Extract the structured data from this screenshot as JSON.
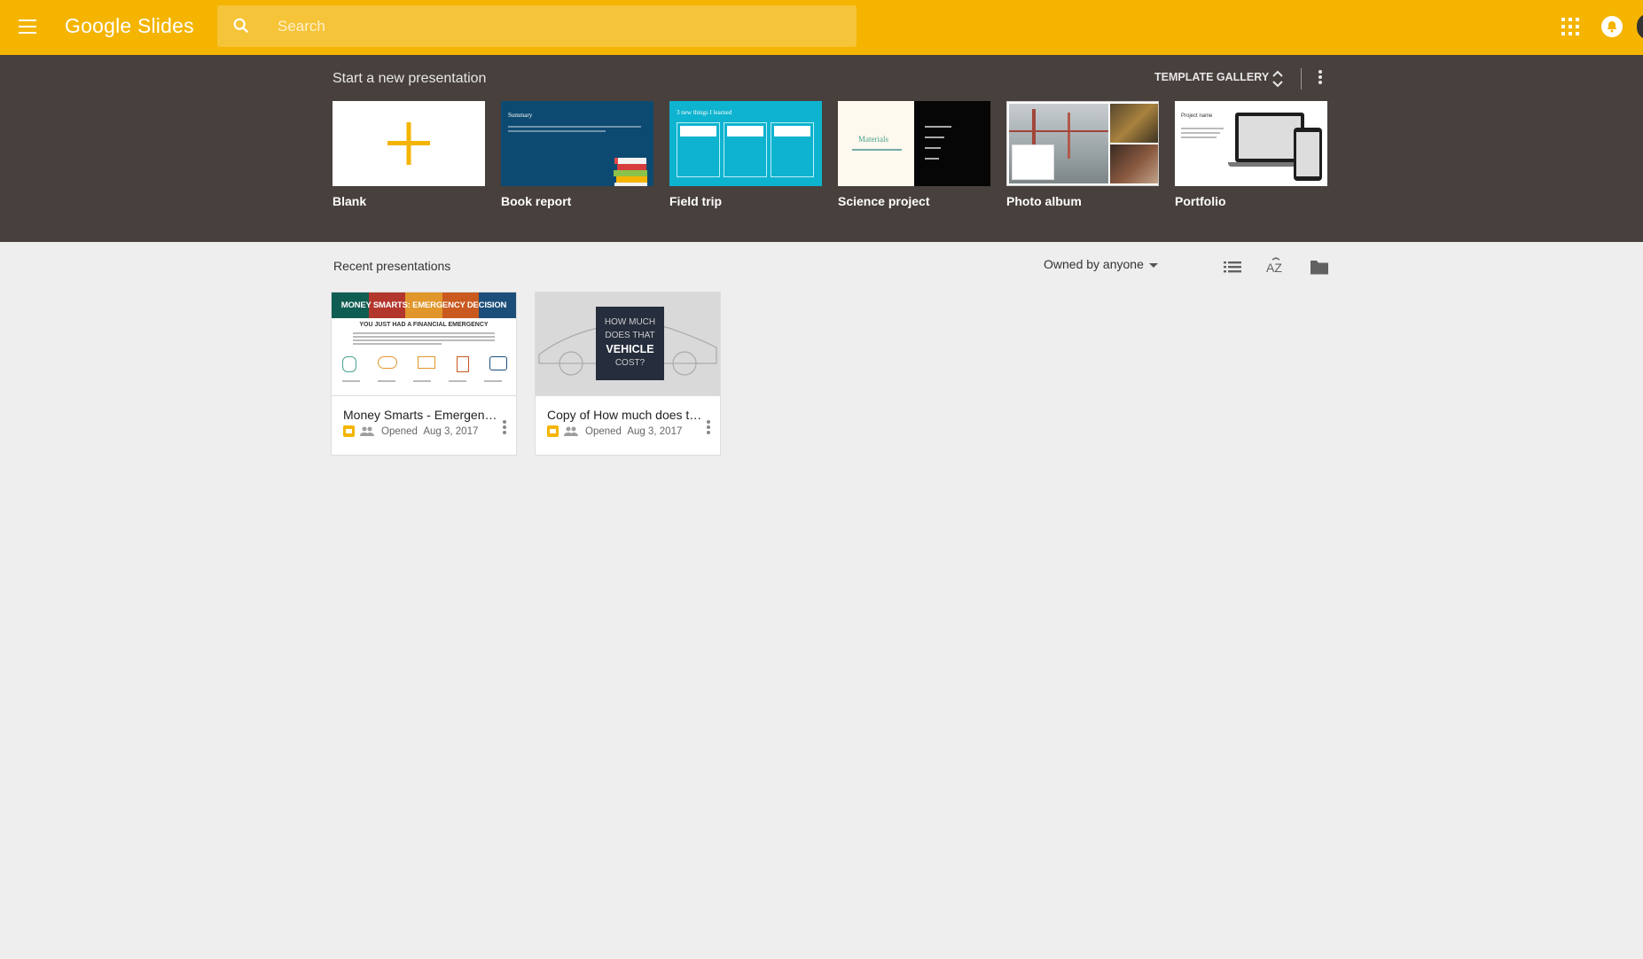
{
  "app": {
    "brand": "Google Slides",
    "brand_color": "#f4b400",
    "band_color": "#47403c"
  },
  "header": {
    "menu_icon": "hamburger-menu-icon",
    "search_placeholder": "Search",
    "apps_icon": "apps-grid-icon",
    "notifications_icon": "notifications-bell-icon"
  },
  "templates": {
    "section_title": "Start a new presentation",
    "gallery_label": "TEMPLATE GALLERY",
    "items": [
      {
        "label": "Blank"
      },
      {
        "label": "Book report",
        "thumb_title": "Summary"
      },
      {
        "label": "Field trip",
        "thumb_title": "3 new things I learned"
      },
      {
        "label": "Science project",
        "thumb_title": "Materials"
      },
      {
        "label": "Photo album"
      },
      {
        "label": "Portfolio",
        "thumb_title": "Project name"
      }
    ]
  },
  "recent": {
    "section_title": "Recent presentations",
    "owner_filter": "Owned by anyone",
    "view_icons": [
      "list-view-icon",
      "sort-az-icon",
      "folder-icon"
    ],
    "files": [
      {
        "title": "Money Smarts - Emergency Decision",
        "opened_label": "Opened",
        "opened_date": "Aug 3, 2017",
        "preview_banner": "MONEY SMARTS: EMERGENCY DECISION",
        "preview_heading": "YOU JUST HAD A FINANCIAL EMERGENCY"
      },
      {
        "title": "Copy of How much does that vehicle cost?",
        "opened_label": "Opened",
        "opened_date": "Aug 3, 2017",
        "preview_line1": "HOW MUCH",
        "preview_line2": "DOES THAT",
        "preview_line3": "VEHICLE",
        "preview_line4": "COST?"
      }
    ]
  }
}
